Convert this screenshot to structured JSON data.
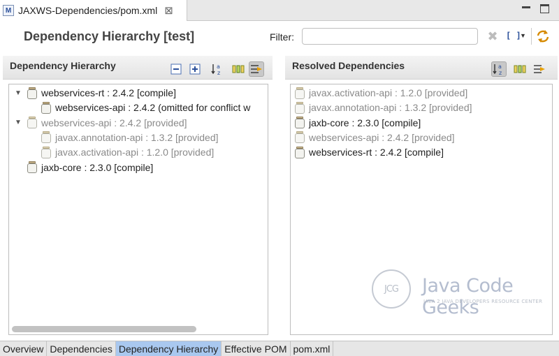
{
  "editor_tab": {
    "icon": "M",
    "title": "JAXWS-Dependencies/pom.xml",
    "close": "⊠"
  },
  "header": {
    "title": "Dependency Hierarchy [test]",
    "filter_label": "Filter:",
    "filter_value": "",
    "filter_placeholder": ""
  },
  "left": {
    "title": "Dependency Hierarchy",
    "rows": [
      {
        "text": "webservices-rt : 2.4.2 [compile]",
        "state": "normal",
        "twisty": "▼",
        "indent": 0
      },
      {
        "text": "webservices-api : 2.4.2 (omitted for conflict w",
        "state": "normal",
        "twisty": "",
        "indent": 1
      },
      {
        "text": "webservices-api : 2.4.2 [provided]",
        "state": "dim",
        "twisty": "▼",
        "indent": 0
      },
      {
        "text": "javax.annotation-api : 1.3.2 [provided]",
        "state": "dim",
        "twisty": "",
        "indent": 1
      },
      {
        "text": "javax.activation-api : 1.2.0 [provided]",
        "state": "dim",
        "twisty": "",
        "indent": 1
      },
      {
        "text": "jaxb-core : 2.3.0 [compile]",
        "state": "normal",
        "twisty": "",
        "indent": 0
      }
    ]
  },
  "right": {
    "title": "Resolved Dependencies",
    "rows": [
      {
        "text": "javax.activation-api : 1.2.0 [provided]",
        "state": "dim"
      },
      {
        "text": "javax.annotation-api : 1.3.2 [provided]",
        "state": "dim"
      },
      {
        "text": "jaxb-core : 2.3.0 [compile]",
        "state": "normal"
      },
      {
        "text": "webservices-api : 2.4.2 [provided]",
        "state": "dim"
      },
      {
        "text": "webservices-rt : 2.4.2 [compile]",
        "state": "normal"
      }
    ]
  },
  "watermark": {
    "logo_text": "JCG",
    "title": "Java Code Geeks",
    "subtitle": "JAVA 2 JAVA DEVELOPERS RESOURCE CENTER"
  },
  "page_tabs": [
    {
      "label": "Overview",
      "active": false
    },
    {
      "label": "Dependencies",
      "active": false
    },
    {
      "label": "Dependency Hierarchy",
      "active": true
    },
    {
      "label": "Effective POM",
      "active": false
    },
    {
      "label": "pom.xml",
      "active": false
    }
  ],
  "colors": {
    "active_tab": "#a9c8ef",
    "dim_text": "#8a8a8a",
    "icon_blue": "#2a4f9a"
  },
  "icons": {
    "collapse_all": "collapse-all-icon",
    "expand_all": "expand-all-icon",
    "sort": "sort-icon",
    "show_group_id": "show-group-id-icon",
    "filter_toggle": "filter-toggle-icon",
    "clear": "clear-filter-icon",
    "refresh": "refresh-icon"
  }
}
